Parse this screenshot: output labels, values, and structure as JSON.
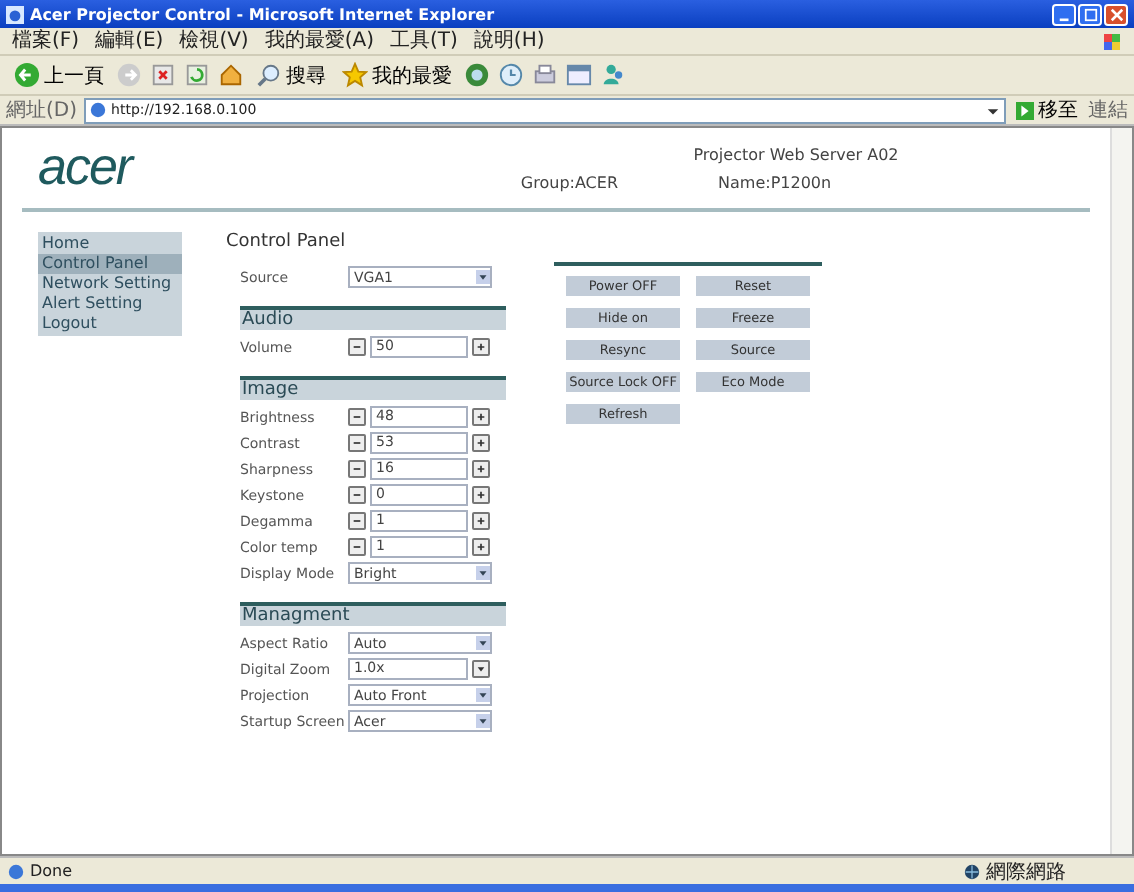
{
  "window": {
    "title": "Acer Projector Control - Microsoft Internet Explorer"
  },
  "menu": [
    "檔案(F)",
    "編輯(E)",
    "檢視(V)",
    "我的最愛(A)",
    "工具(T)",
    "說明(H)"
  ],
  "toolbar": {
    "back": "上一頁",
    "search": "搜尋",
    "favorites": "我的最愛"
  },
  "address": {
    "label": "網址(D)",
    "url": "http://192.168.0.100",
    "go": "移至",
    "links": "連結"
  },
  "logo": "acer",
  "header": {
    "title": "Projector Web Server A02",
    "group": "Group:ACER",
    "name": "Name:P1200n"
  },
  "nav": [
    {
      "label": "Home",
      "selected": false
    },
    {
      "label": "Control Panel",
      "selected": true
    },
    {
      "label": "Network Setting",
      "selected": false
    },
    {
      "label": "Alert Setting",
      "selected": false
    },
    {
      "label": "Logout",
      "selected": false
    }
  ],
  "panel": {
    "title": "Control Panel",
    "sections": [
      {
        "rows": [
          {
            "kind": "select",
            "label": "Source",
            "value": "VGA1"
          }
        ]
      },
      {
        "title": "Audio",
        "rows": [
          {
            "kind": "stepper",
            "label": "Volume",
            "value": "50"
          }
        ]
      },
      {
        "title": "Image",
        "rows": [
          {
            "kind": "stepper",
            "label": "Brightness",
            "value": "48"
          },
          {
            "kind": "stepper",
            "label": "Contrast",
            "value": "53"
          },
          {
            "kind": "stepper",
            "label": "Sharpness",
            "value": "16"
          },
          {
            "kind": "stepper",
            "label": "Keystone",
            "value": "0"
          },
          {
            "kind": "stepper",
            "label": "Degamma",
            "value": "1"
          },
          {
            "kind": "stepper",
            "label": "Color temp",
            "value": "1"
          },
          {
            "kind": "select",
            "label": "Display Mode",
            "value": "Bright"
          }
        ]
      },
      {
        "title": "Managment",
        "rows": [
          {
            "kind": "select",
            "label": "Aspect Ratio",
            "value": "Auto"
          },
          {
            "kind": "spinner",
            "label": "Digital Zoom",
            "value": "1.0x"
          },
          {
            "kind": "select",
            "label": "Projection",
            "value": "Auto Front"
          },
          {
            "kind": "select",
            "label": "Startup Screen",
            "value": "Acer"
          }
        ]
      }
    ]
  },
  "buttons": [
    "Power OFF",
    "Reset",
    "Hide on",
    "Freeze",
    "Resync",
    "Source",
    "Source Lock OFF",
    "Eco Mode",
    "Refresh"
  ],
  "status": {
    "text": "Done",
    "zone": "網際網路"
  }
}
